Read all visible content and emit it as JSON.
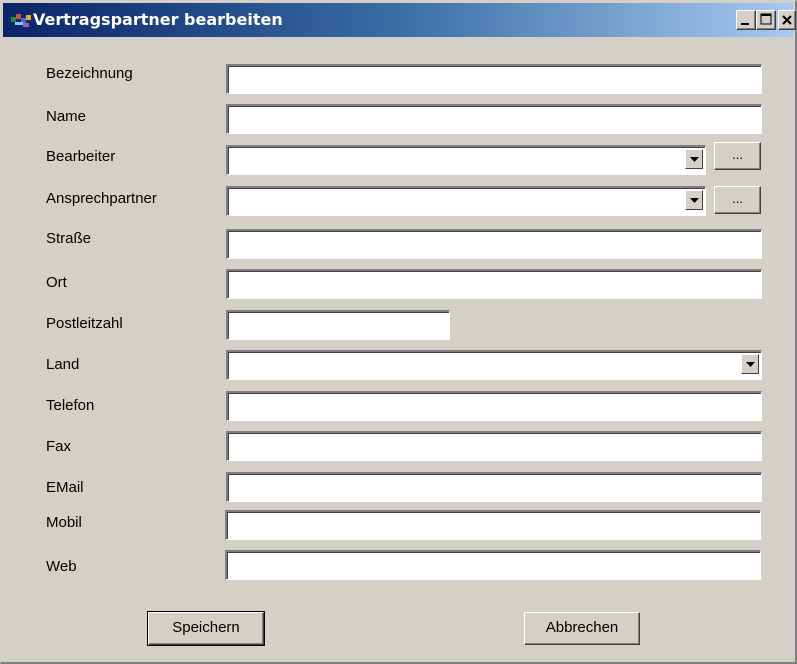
{
  "window": {
    "title": "Vertragspartner bearbeiten"
  },
  "form": {
    "bezeichnung": {
      "label": "Bezeichnung",
      "value": ""
    },
    "name": {
      "label": "Name",
      "value": ""
    },
    "bearbeiter": {
      "label": "Bearbeiter",
      "value": "",
      "browse_label": "..."
    },
    "ansprechpartner": {
      "label": "Ansprechpartner",
      "value": "",
      "browse_label": "..."
    },
    "strasse": {
      "label": "Straße",
      "value": ""
    },
    "ort": {
      "label": "Ort",
      "value": ""
    },
    "postleitzahl": {
      "label": "Postleitzahl",
      "value": ""
    },
    "land": {
      "label": "Land",
      "value": ""
    },
    "telefon": {
      "label": "Telefon",
      "value": ""
    },
    "fax": {
      "label": "Fax",
      "value": ""
    },
    "email": {
      "label": "EMail",
      "value": ""
    },
    "mobil": {
      "label": "Mobil",
      "value": ""
    },
    "web": {
      "label": "Web",
      "value": ""
    }
  },
  "buttons": {
    "save": "Speichern",
    "cancel": "Abbrechen"
  },
  "colors": {
    "dialog_background": "#d4d0c8",
    "titlebar_start": "#0a246a",
    "titlebar_end": "#a6caf0"
  },
  "icons": {
    "app": "app-window-icon",
    "minimize": "minimize-icon",
    "maximize": "maximize-icon",
    "close": "close-icon",
    "dropdown": "chevron-down-icon"
  }
}
